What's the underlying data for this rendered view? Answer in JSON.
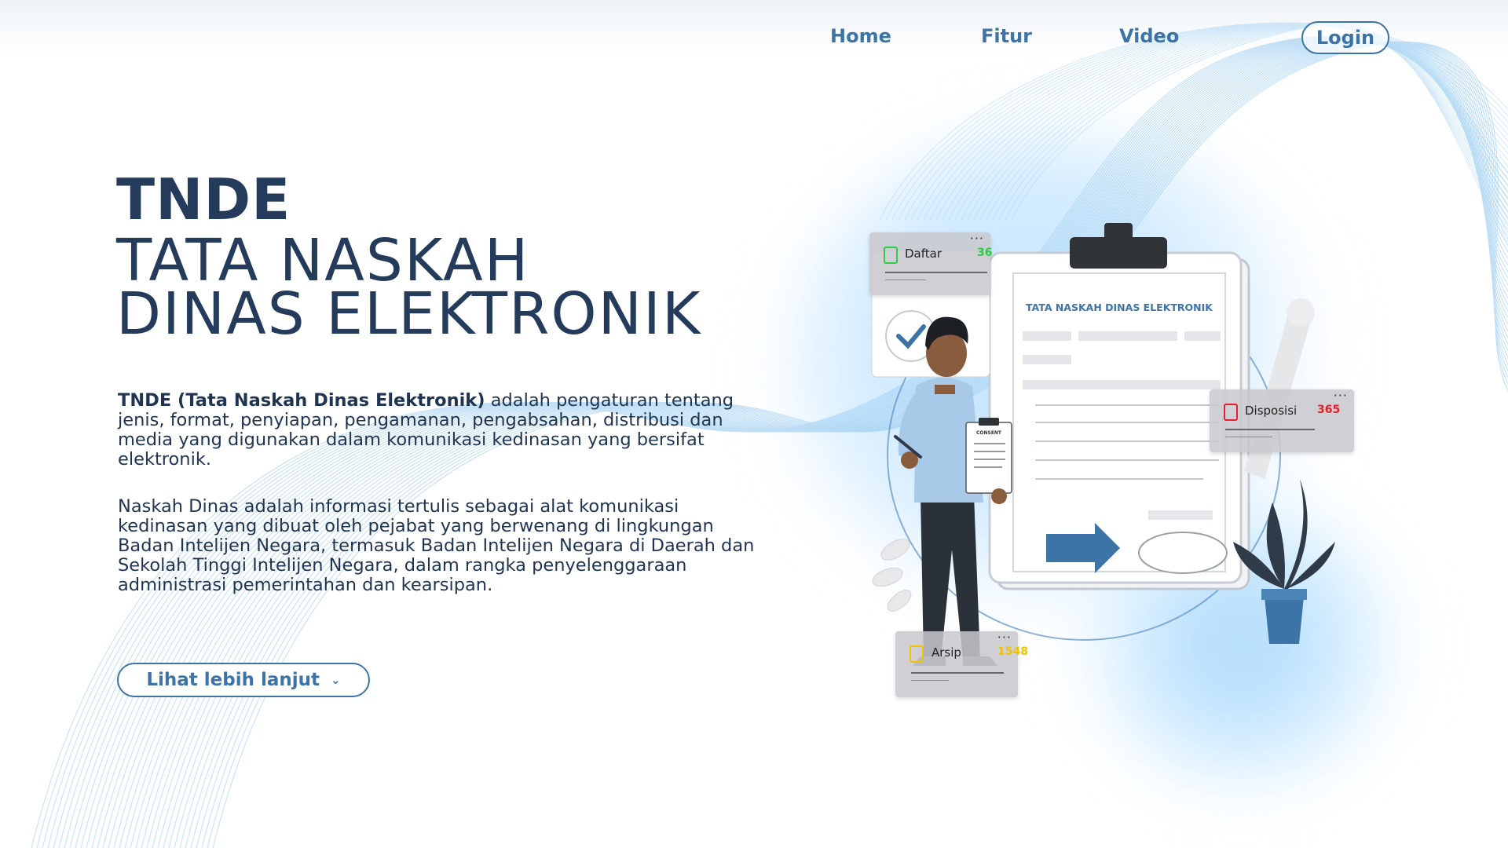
{
  "nav": {
    "home": "Home",
    "fitur": "Fitur",
    "video": "Video",
    "login": "Login"
  },
  "hero": {
    "brand": "TNDE",
    "title_line1": "TATA NASKAH",
    "title_line2": "DINAS ELEKTRONIK",
    "para1_bold": "TNDE (Tata Naskah Dinas Elektronik)",
    "para1_rest": " adalah pengaturan tentang jenis, format, penyiapan, pengamanan, pengabsahan, distribusi dan media yang digunakan dalam komunikasi kedinasan yang bersifat elektronik.",
    "para2": "Naskah Dinas adalah informasi tertulis sebagai alat komunikasi kedinasan yang dibuat oleh pejabat yang berwenang di lingkungan Badan Intelijen Negara, termasuk Badan Intelijen Negara di Daerah dan Sekolah Tinggi Intelijen Negara, dalam rangka penyelenggaraan administrasi pemerintahan dan kearsipan.",
    "more_button": "Lihat lebih lanjut"
  },
  "illustration": {
    "document_title": "TATA NASKAH DINAS ELEKTRONIK",
    "clipboard_label": "CONSENT",
    "cards": {
      "daftar": {
        "label": "Daftar",
        "value": "36",
        "color": "#2ecc40"
      },
      "disposisi": {
        "label": "Disposisi",
        "value": "365",
        "color": "#e0202a"
      },
      "arsip": {
        "label": "Arsip",
        "value": "1548",
        "color": "#f2c200"
      }
    },
    "accent": "#3d74a8"
  }
}
